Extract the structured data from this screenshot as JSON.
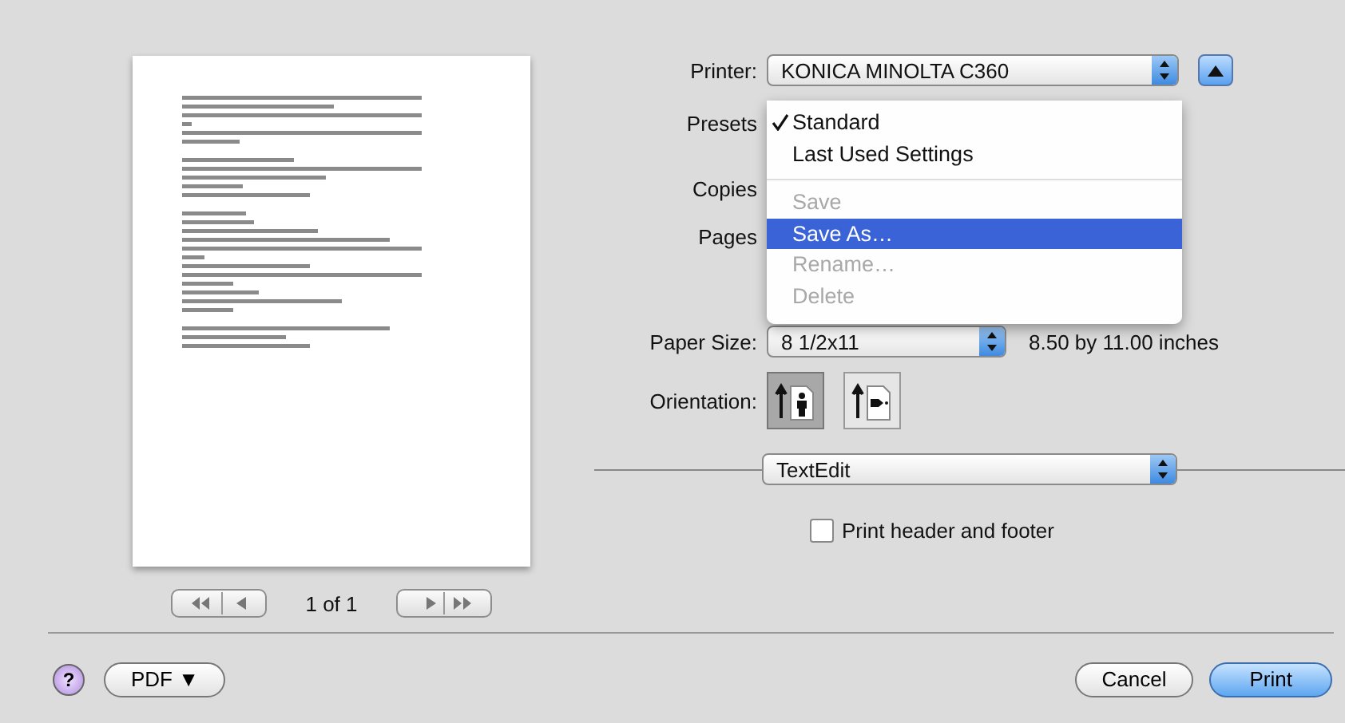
{
  "printer": {
    "label": "Printer:",
    "value": "KONICA MINOLTA C360"
  },
  "presets": {
    "label": "Presets",
    "menu": [
      [
        {
          "label": "Standard",
          "checked": true,
          "selected": false,
          "disabled": false
        },
        {
          "label": "Last Used Settings",
          "checked": false,
          "selected": false,
          "disabled": false
        }
      ],
      [
        {
          "label": "Save",
          "checked": false,
          "selected": false,
          "disabled": true
        },
        {
          "label": "Save As…",
          "checked": false,
          "selected": true,
          "disabled": false
        },
        {
          "label": "Rename…",
          "checked": false,
          "selected": false,
          "disabled": true
        },
        {
          "label": "Delete",
          "checked": false,
          "selected": false,
          "disabled": true
        }
      ]
    ]
  },
  "copies": {
    "label": "Copies"
  },
  "pages": {
    "label": "Pages"
  },
  "paper_size": {
    "label": "Paper Size:",
    "value": "8 1/2x11",
    "description": "8.50 by 11.00 inches"
  },
  "orientation": {
    "label": "Orientation:",
    "options": [
      {
        "kind": "portrait",
        "selected": true
      },
      {
        "kind": "landscape",
        "selected": false
      }
    ]
  },
  "panel_popup": {
    "value": "TextEdit"
  },
  "print_header_footer": {
    "label": "Print header and footer",
    "checked": false
  },
  "preview": {
    "page_indicator": "1 of 1"
  },
  "buttons": {
    "help": "?",
    "pdf": "PDF ▼",
    "cancel": "Cancel",
    "print": "Print"
  }
}
